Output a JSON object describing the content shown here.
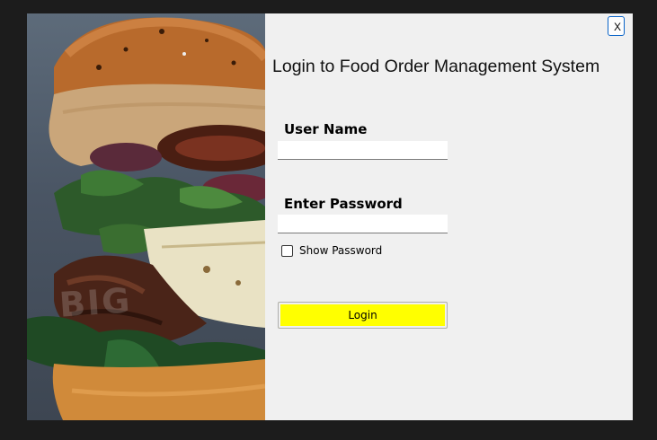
{
  "window": {
    "close_label": "X",
    "title": "Login to Food Order Management System"
  },
  "photo": {
    "watermark": "BIG"
  },
  "form": {
    "username_label": "User Name",
    "username_value": "",
    "password_label": "Enter Password",
    "password_value": "",
    "show_password_label": "Show Password",
    "show_password_checked": false,
    "login_label": "Login"
  },
  "colors": {
    "background": "#1c1c1c",
    "panel": "#f0f0f0",
    "login_button": "#ffff00",
    "close_border": "#0a64c8"
  },
  "icons": {
    "close": "close-icon",
    "checkbox": "checkbox-icon"
  }
}
